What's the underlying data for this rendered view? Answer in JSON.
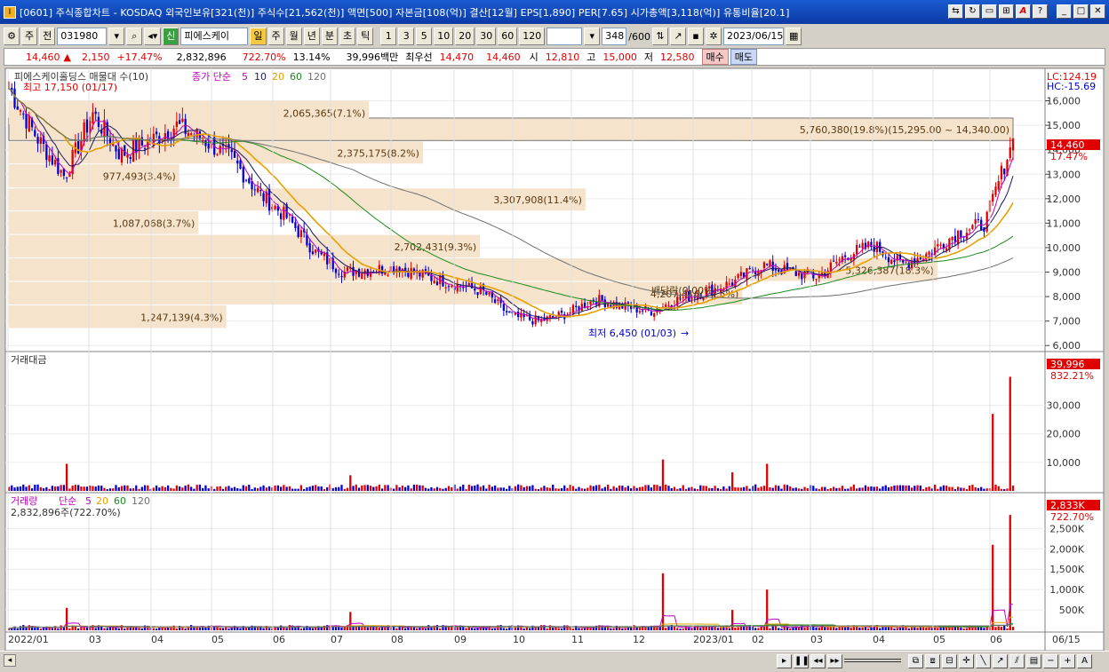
{
  "window": {
    "title": "[0601] 주식종합차트 - KOSDAQ 외국인보유[321(천)] 주식수[21,562(천)] 액면[500] 자본금[108(억)] 결산[12월] EPS[1,890] PER[7.65] 시가총액[3,118(억)] 유통비율[20.1]"
  },
  "toolbar": {
    "mode": "주",
    "prev": "전",
    "code": "031980",
    "name": "피에스케이",
    "period_day": "일",
    "period_week": "주",
    "period_month": "월",
    "period_year": "년",
    "period_min": "분",
    "period_sec": "초",
    "period_tick": "틱",
    "intervals": [
      "1",
      "3",
      "5",
      "10",
      "20",
      "30",
      "60",
      "120"
    ],
    "count": "348",
    "count_max": "/600",
    "date": "2023/06/15",
    "new_label": "신"
  },
  "quote": {
    "price": "14,460",
    "change_arrow": "▲",
    "change": "2,150",
    "change_pct": "+17.47%",
    "volume": "2,832,896",
    "volume_ratio": "722.70%",
    "turnover": "13.14%",
    "amount": "39,996백만",
    "best_ask_label": "최우선",
    "best_ask": "14,470",
    "best_bid": "14,460",
    "open_label": "시",
    "open": "12,810",
    "high_label": "고",
    "high": "15,000",
    "low_label": "저",
    "low": "12,580",
    "buy": "매수",
    "sell": "매도"
  },
  "colors": {
    "up": "#e00000",
    "down": "#0000d0",
    "ma5": "#c000c0",
    "ma10": "#1a1a60",
    "ma20": "#e6a000",
    "ma60": "#1a8a1a",
    "ma120": "#707070",
    "band": "#f5e3cc"
  },
  "price_panel": {
    "legend_name": "피에스케이홀딩스 매물대 수(10)",
    "legend_close": "종가 단순",
    "legend_periods": [
      "5",
      "10",
      "20",
      "60",
      "120"
    ],
    "high_label": "최고 17,150 (01/17)",
    "low_label": "최저 6,450 (01/03)",
    "dividend_label": "배당락(0.00%)",
    "lc": "LC:124.19",
    "hc": "HC:-15.69",
    "last_price": "14,460",
    "last_pct": "17.47%",
    "y_ticks": [
      "16,000",
      "15,000",
      "14,000",
      "13,000",
      "12,000",
      "11,000",
      "10,000",
      "9,000",
      "8,000",
      "7,000",
      "6,000"
    ]
  },
  "chart_data": [
    {
      "type": "candlestick",
      "title": "피에스케이홀딩스 매물대 수(10)",
      "ylim": [
        6000,
        16500
      ],
      "moving_averages": [
        "5",
        "10",
        "20",
        "60",
        "120"
      ],
      "price_bands": [
        {
          "low": 15295,
          "high": 14340,
          "label": "5,760,380(19.8%)(15,295.00 ~ 14,340.00)"
        },
        {
          "low": 16000,
          "high": 15000,
          "label": "2,065,365(7.1%)"
        },
        {
          "low": 14340,
          "high": 13400,
          "label": "2,375,175(8.2%)"
        },
        {
          "low": 13400,
          "high": 12420,
          "label": "977,493(3.4%)"
        },
        {
          "low": 12420,
          "high": 11480,
          "label": "3,307,908(11.4%)"
        },
        {
          "low": 11480,
          "high": 10520,
          "label": "1,087,068(3.7%)"
        },
        {
          "low": 10520,
          "high": 9560,
          "label": "2,702,431(9.3%)"
        },
        {
          "low": 9560,
          "high": 8600,
          "label": "5,326,387(18.3%)"
        },
        {
          "low": 8600,
          "high": 7640,
          "label": "4,207,416(14.5%)"
        },
        {
          "low": 7640,
          "high": 6680,
          "label": "1,247,139(4.3%)"
        }
      ],
      "close_series": [
        {
          "date": "2022/01",
          "close": 16500
        },
        {
          "date": "2022/01/17",
          "close": 14500
        },
        {
          "date": "2022/02",
          "close": 12900
        },
        {
          "date": "2022/02 mid",
          "close": 15500
        },
        {
          "date": "2022/03",
          "close": 13800
        },
        {
          "date": "2022/03 mid",
          "close": 14300
        },
        {
          "date": "2022/04",
          "close": 15000
        },
        {
          "date": "2022/04 mid",
          "close": 14400
        },
        {
          "date": "2022/05",
          "close": 13600
        },
        {
          "date": "2022/05 mid",
          "close": 12200
        },
        {
          "date": "2022/06",
          "close": 11200
        },
        {
          "date": "2022/06 mid",
          "close": 9800
        },
        {
          "date": "2022/07",
          "close": 9000
        },
        {
          "date": "2022/07 mid",
          "close": 9100
        },
        {
          "date": "2022/08",
          "close": 9200
        },
        {
          "date": "2022/08 mid",
          "close": 8800
        },
        {
          "date": "2022/09",
          "close": 8500
        },
        {
          "date": "2022/09 mid",
          "close": 8200
        },
        {
          "date": "2022/10",
          "close": 7200
        },
        {
          "date": "2022/10 mid",
          "close": 7000
        },
        {
          "date": "2022/11",
          "close": 7300
        },
        {
          "date": "2022/11 mid",
          "close": 7900
        },
        {
          "date": "2022/12",
          "close": 7600
        },
        {
          "date": "2022/12 mid",
          "close": 7400
        },
        {
          "date": "2023/01",
          "close": 7900
        },
        {
          "date": "2023/01 mid",
          "close": 8200
        },
        {
          "date": "2023/02",
          "close": 8600
        },
        {
          "date": "2023/02 mid",
          "close": 9300
        },
        {
          "date": "2023/03",
          "close": 9000
        },
        {
          "date": "2023/03 mid",
          "close": 8800
        },
        {
          "date": "2023/04",
          "close": 9700
        },
        {
          "date": "2023/04 mid",
          "close": 10100
        },
        {
          "date": "2023/05",
          "close": 9300
        },
        {
          "date": "2023/05 mid",
          "close": 9800
        },
        {
          "date": "2023/06",
          "close": 10600
        },
        {
          "date": "2023/06/12",
          "close": 11000
        },
        {
          "date": "2023/06/15",
          "close": 14460
        }
      ]
    },
    {
      "type": "bar",
      "title": "거래대금",
      "last_value": "39,996",
      "last_pct": "832.21%",
      "y_ticks": [
        "30,000",
        "20,000",
        "10,000"
      ],
      "ylim": [
        0,
        42000
      ],
      "spikes": [
        {
          "date": "2022/02",
          "value": 9500
        },
        {
          "date": "2022/07",
          "value": 5500
        },
        {
          "date": "2023/01",
          "value": 11000
        },
        {
          "date": "2023/02",
          "value": 6500
        },
        {
          "date": "2023/02 mid",
          "value": 9500
        },
        {
          "date": "2023/06/14",
          "value": 27000
        },
        {
          "date": "2023/06/15",
          "value": 39996
        }
      ]
    },
    {
      "type": "bar",
      "title": "거래량",
      "legend_periods": [
        "5",
        "20",
        "60",
        "120"
      ],
      "legend_label": "단순",
      "current_label": "2,832,896주(722.70%)",
      "last_value": "2,833K",
      "last_pct": "722.70%",
      "y_ticks": [
        "2,500,000",
        "2,000,000",
        "1,500,000",
        "1,000,000",
        "500,000"
      ],
      "ylim": [
        0,
        2900000
      ],
      "spikes": [
        {
          "date": "2022/02",
          "value": 550000
        },
        {
          "date": "2022/07",
          "value": 450000
        },
        {
          "date": "2023/01",
          "value": 1400000
        },
        {
          "date": "2023/02",
          "value": 500000
        },
        {
          "date": "2023/02 mid",
          "value": 1000000
        },
        {
          "date": "2023/06/14",
          "value": 2100000
        },
        {
          "date": "2023/06/15",
          "value": 2832896
        }
      ]
    }
  ],
  "x_axis": {
    "labels": [
      "2022/01",
      "03",
      "04",
      "05",
      "06",
      "07",
      "08",
      "09",
      "10",
      "11",
      "12",
      "2023/01",
      "02",
      "03",
      "04",
      "05",
      "06"
    ],
    "last_label": "06/15"
  }
}
